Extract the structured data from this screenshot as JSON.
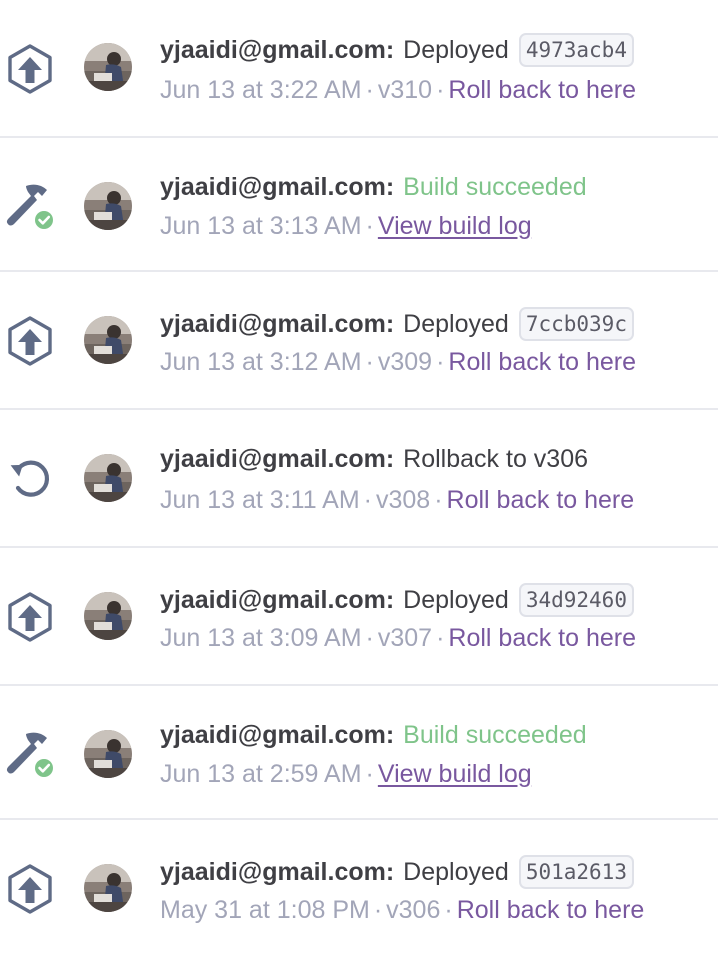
{
  "activity": [
    {
      "type": "deploy",
      "icon": "deploy-arrow-icon",
      "user": "yjaaidi@gmail.com:",
      "action": "Deployed",
      "commit": "4973acb4",
      "time": "Jun 13 at 3:22 AM",
      "version": "v310",
      "link": "Roll back to here"
    },
    {
      "type": "build",
      "icon": "build-hammer-check-icon",
      "user": "yjaaidi@gmail.com:",
      "action": "Build succeeded",
      "time": "Jun 13 at 3:13 AM",
      "link": "View build log"
    },
    {
      "type": "deploy",
      "icon": "deploy-arrow-icon",
      "user": "yjaaidi@gmail.com:",
      "action": "Deployed",
      "commit": "7ccb039c",
      "time": "Jun 13 at 3:12 AM",
      "version": "v309",
      "link": "Roll back to here"
    },
    {
      "type": "rollback",
      "icon": "rollback-circular-arrow-icon",
      "user": "yjaaidi@gmail.com:",
      "action": "Rollback to v306",
      "time": "Jun 13 at 3:11 AM",
      "version": "v308",
      "link": "Roll back to here"
    },
    {
      "type": "deploy",
      "icon": "deploy-arrow-icon",
      "user": "yjaaidi@gmail.com:",
      "action": "Deployed",
      "commit": "34d92460",
      "time": "Jun 13 at 3:09 AM",
      "version": "v307",
      "link": "Roll back to here"
    },
    {
      "type": "build",
      "icon": "build-hammer-check-icon",
      "user": "yjaaidi@gmail.com:",
      "action": "Build succeeded",
      "time": "Jun 13 at 2:59 AM",
      "link": "View build log"
    },
    {
      "type": "deploy",
      "icon": "deploy-arrow-icon",
      "user": "yjaaidi@gmail.com:",
      "action": "Deployed",
      "commit": "501a2613",
      "time": "May 31 at 1:08 PM",
      "version": "v306",
      "link": "Roll back to here"
    }
  ],
  "separator": "·",
  "colors": {
    "text": "#3f3f44",
    "muted": "#a2a5b8",
    "link": "#79589f",
    "success": "#7fc48a",
    "icon": "#5f6b86",
    "divider": "#e8e9ee"
  }
}
